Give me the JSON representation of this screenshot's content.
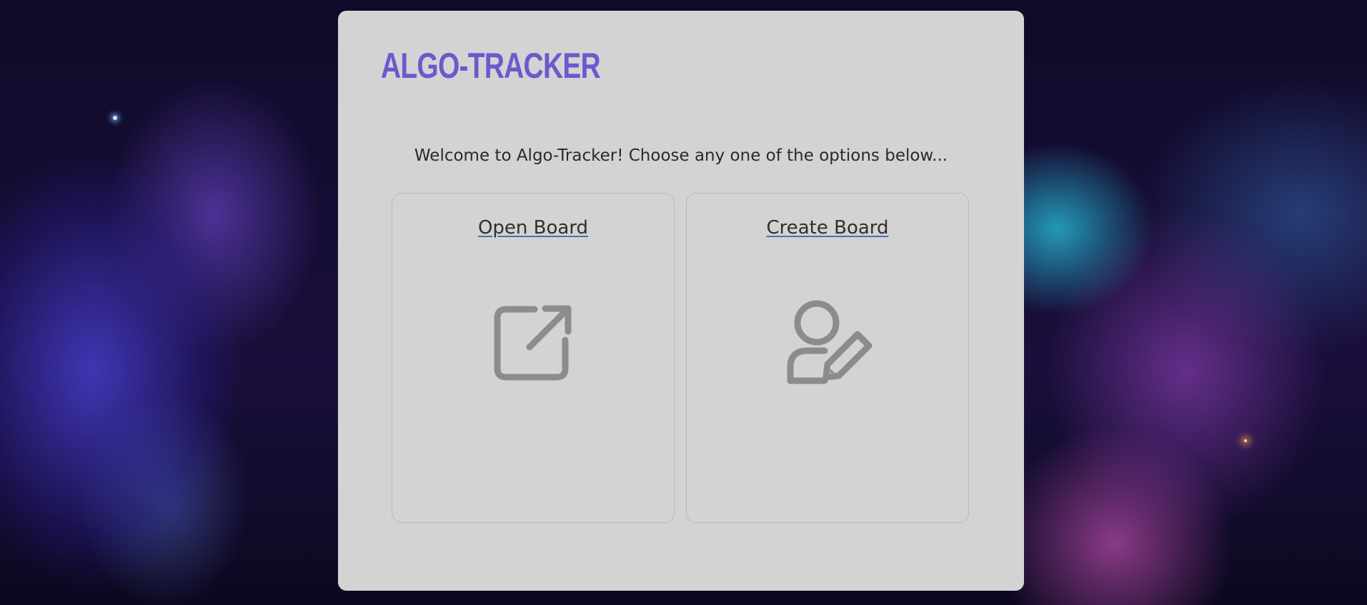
{
  "app": {
    "title": "ALGO-TRACKER"
  },
  "welcome_message": "Welcome to Algo-Tracker! Choose any one of the options below...",
  "cards": [
    {
      "label": "Open Board",
      "icon": "external-link-icon"
    },
    {
      "label": "Create Board",
      "icon": "user-edit-icon"
    }
  ],
  "colors": {
    "brand": "#6a5acd",
    "panel": "#d3d3d3",
    "icon": "#8c8c8c"
  }
}
